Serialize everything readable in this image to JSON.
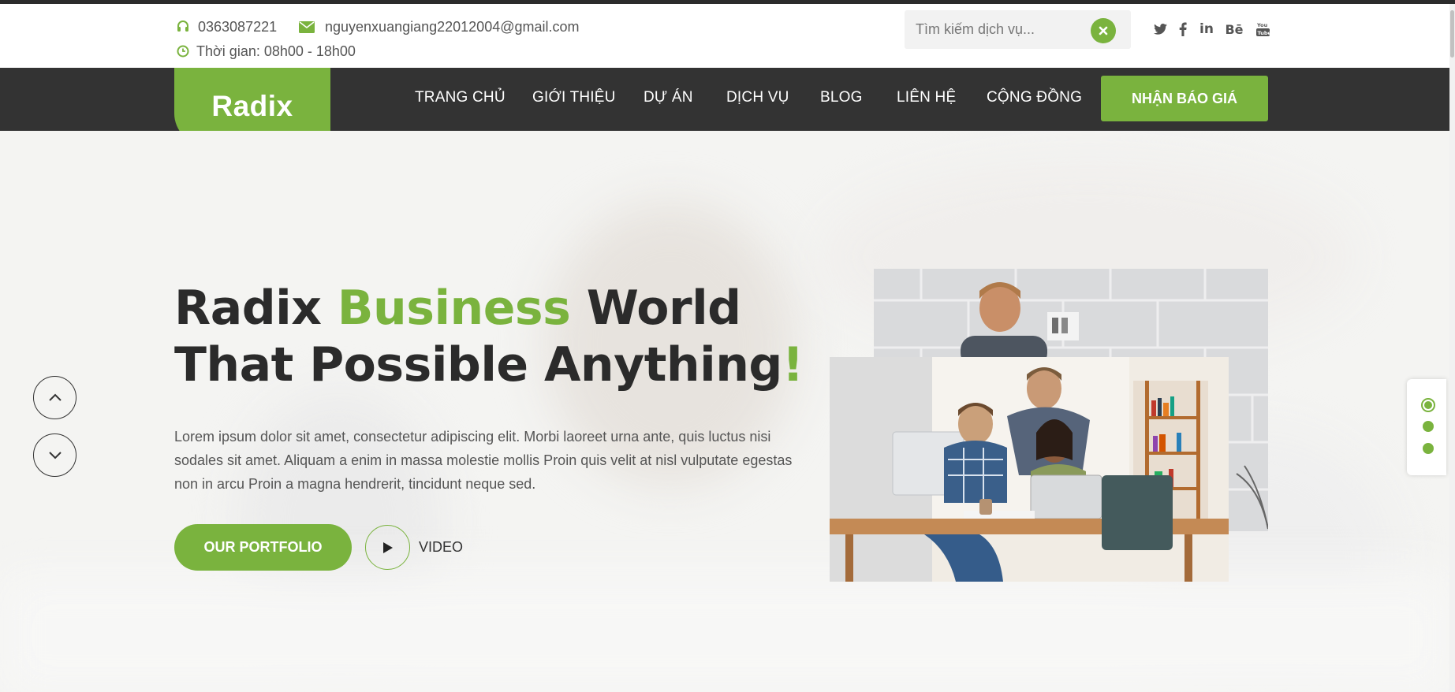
{
  "topbar": {
    "phone": "0363087221",
    "email": "nguyenxuangiang22012004@gmail.com",
    "hours": "Thời gian: 08h00 - 18h00",
    "search_placeholder": "Tìm kiếm dịch vụ...",
    "social": [
      {
        "icon": "twitter-icon",
        "glyph": "🐦"
      },
      {
        "icon": "facebook-icon",
        "glyph": "f"
      },
      {
        "icon": "linkedin-icon",
        "glyph": "in"
      },
      {
        "icon": "behance-icon",
        "glyph": "Bē"
      },
      {
        "icon": "youtube-icon",
        "glyph": "You"
      }
    ]
  },
  "brand": {
    "logo": "Radix",
    "accent_color": "#7ab33e",
    "dark_color": "#333333"
  },
  "nav": {
    "items": [
      "TRANG CHỦ",
      "GIỚI THIỆU",
      "DỰ ÁN",
      "DỊCH VỤ",
      "BLOG",
      "LIÊN HỆ",
      "CỘNG ĐỒNG"
    ],
    "cta": "NHẬN BÁO GIÁ"
  },
  "hero": {
    "title_part1": "Radix ",
    "title_highlight": "Business",
    "title_part2": " World",
    "title_line2": "That Possible Anything",
    "title_exclaim": "!",
    "description": "Lorem ipsum dolor sit amet, consectetur adipiscing elit. Morbi laoreet urna ante, quis luctus nisi sodales sit amet. Aliquam a enim in massa molestie mollis Proin quis velit at nisl vulputate egestas non in arcu Proin a magna hendrerit, tincidunt neque sed.",
    "portfolio_button": "OUR PORTFOLIO",
    "video_label": "VIDEO"
  },
  "slider": {
    "dot_count": 3,
    "active_dot": 1
  }
}
